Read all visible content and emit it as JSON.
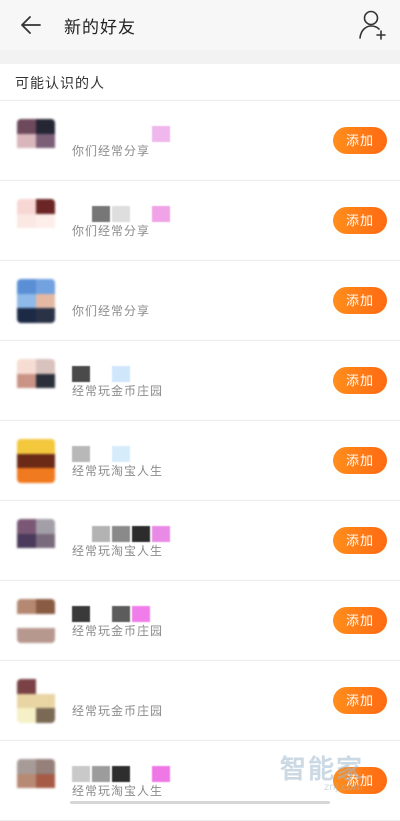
{
  "header": {
    "title": "新的好友",
    "back_icon": "arrow-left-icon",
    "add_icon": "person-plus-icon"
  },
  "section_title": "可能认识的人",
  "rows": [
    {
      "subtitle": "你们经常分享",
      "button": "添加",
      "avatar_colors": [
        "#6d4a5b",
        "#252534",
        "#d8b6bc",
        "#7b5f78",
        "#ffffff",
        "#ffffff"
      ],
      "name_colors": [
        "#ffffff",
        "#ffffff",
        "#ffffff",
        "#ffffff",
        "#efb7ec"
      ]
    },
    {
      "subtitle": "你们经常分享",
      "button": "添加",
      "avatar_colors": [
        "#f7d7d4",
        "#6b2525",
        "#fbe8e3",
        "#fdeeea",
        "#ffffff",
        "#ffffff"
      ],
      "name_colors": [
        "#ffffff",
        "#777777",
        "#dedede",
        "#ffffff",
        "#f0a3e6"
      ]
    },
    {
      "subtitle": "你们经常分享",
      "button": "添加",
      "avatar_colors": [
        "#5a8fd6",
        "#72a2e0",
        "#8eb9e8",
        "#e4b9a4",
        "#1c2a46",
        "#2a3245"
      ],
      "name_colors": [
        "#ffffff",
        "#ffffff",
        "#ffffff",
        "#ffffff",
        "#ffffff"
      ]
    },
    {
      "subtitle": "经常玩金币庄园",
      "button": "添加",
      "avatar_colors": [
        "#f6dcd2",
        "#d9c2bd",
        "#c99485",
        "#2a2f3a",
        "#ffffff",
        "#ffffff"
      ],
      "name_colors": [
        "#4a4a4a",
        "#ffffff",
        "#cfe6fb",
        "#ffffff",
        "#ffffff"
      ]
    },
    {
      "subtitle": "经常玩淘宝人生",
      "button": "添加",
      "avatar_colors": [
        "#f3c83d",
        "#f3c83d",
        "#6b2a16",
        "#6b2a16",
        "#f07a1f",
        "#f07a1f"
      ],
      "name_colors": [
        "#b8b8b8",
        "#ffffff",
        "#d7ecfb",
        "#ffffff",
        "#ffffff"
      ]
    },
    {
      "subtitle": "经常玩淘宝人生",
      "button": "添加",
      "avatar_colors": [
        "#7a5775",
        "#a39fa8",
        "#4b3a5b",
        "#7a6a7d",
        "#ffffff",
        "#ffffff"
      ],
      "name_colors": [
        "#ffffff",
        "#b3b3b3",
        "#8a8a8a",
        "#2c2c2c",
        "#e98be6"
      ]
    },
    {
      "subtitle": "经常玩金币庄园",
      "button": "添加",
      "avatar_colors": [
        "#b48871",
        "#8a5b43",
        "#ffffff",
        "#ffffff",
        "#b7988f",
        "#b7988f"
      ],
      "name_colors": [
        "#3a3a3a",
        "#ffffff",
        "#5c5c5c",
        "#f07de9",
        "#ffffff"
      ]
    },
    {
      "subtitle": "经常玩金币庄园",
      "button": "添加",
      "avatar_colors": [
        "#7a4245",
        "#ffffff",
        "#e9d5a4",
        "#e9d5a4",
        "#f5f0c6",
        "#7a6a55"
      ],
      "name_colors": [
        "#ffffff",
        "#ffffff",
        "#ffffff",
        "#ffffff",
        "#ffffff"
      ]
    },
    {
      "subtitle": "经常玩淘宝人生",
      "button": "添加",
      "avatar_colors": [
        "#a79b98",
        "#95807a",
        "#b78a74",
        "#a65b46",
        "#ffffff",
        "#ffffff"
      ],
      "name_colors": [
        "#c9c9c9",
        "#9c9c9c",
        "#2e2e2e",
        "#ffffff",
        "#ee78e6"
      ]
    }
  ],
  "watermark": {
    "text": "智能家",
    "url": "znj.com"
  }
}
